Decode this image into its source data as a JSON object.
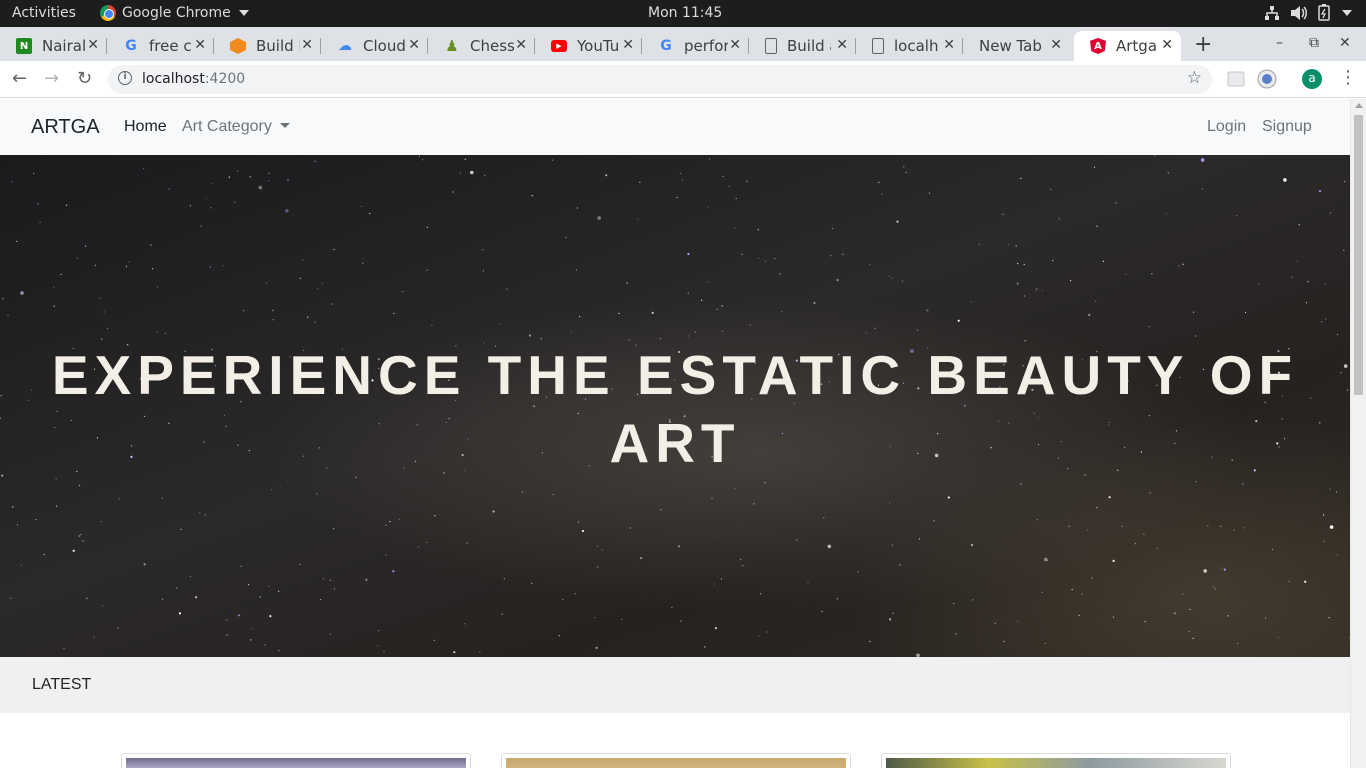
{
  "os_bar": {
    "activities": "Activities",
    "app_name": "Google Chrome",
    "clock": "Mon 11:45"
  },
  "tabs": [
    {
      "title": "Nairal",
      "favicon": "nairaland-icon",
      "color": "#1f8a1f"
    },
    {
      "title": "free cl",
      "favicon": "google-icon",
      "color": "#4285f4"
    },
    {
      "title": "Build F",
      "favicon": "box-icon",
      "color": "#f28b1e"
    },
    {
      "title": "Cloud",
      "favicon": "google-cloud-icon",
      "color": "#4285f4"
    },
    {
      "title": "Chess",
      "favicon": "chess-pawn-icon",
      "color": "#6b8e23"
    },
    {
      "title": "YouTu",
      "favicon": "youtube-icon",
      "color": "#ff0000"
    },
    {
      "title": "perfor",
      "favicon": "google-icon",
      "color": "#4285f4"
    },
    {
      "title": "Build a",
      "favicon": "document-icon",
      "color": "#5f6368"
    },
    {
      "title": "localh",
      "favicon": "document-icon",
      "color": "#5f6368"
    },
    {
      "title": "New Tab",
      "favicon": "",
      "color": ""
    },
    {
      "title": "Artga",
      "favicon": "angular-icon",
      "color": "#dd0031"
    }
  ],
  "address_bar": {
    "host": "localhost",
    "port": ":4200"
  },
  "profile_initial": "a",
  "site": {
    "brand": "ARTGA",
    "nav": {
      "home": "Home",
      "art_category": "Art Category",
      "login": "Login",
      "signup": "Signup"
    },
    "hero_title_line1": "EXPERIENCE THE ESTATIC BEAUTY OF",
    "hero_title_line2": "ART",
    "latest_heading": "LATEST"
  }
}
